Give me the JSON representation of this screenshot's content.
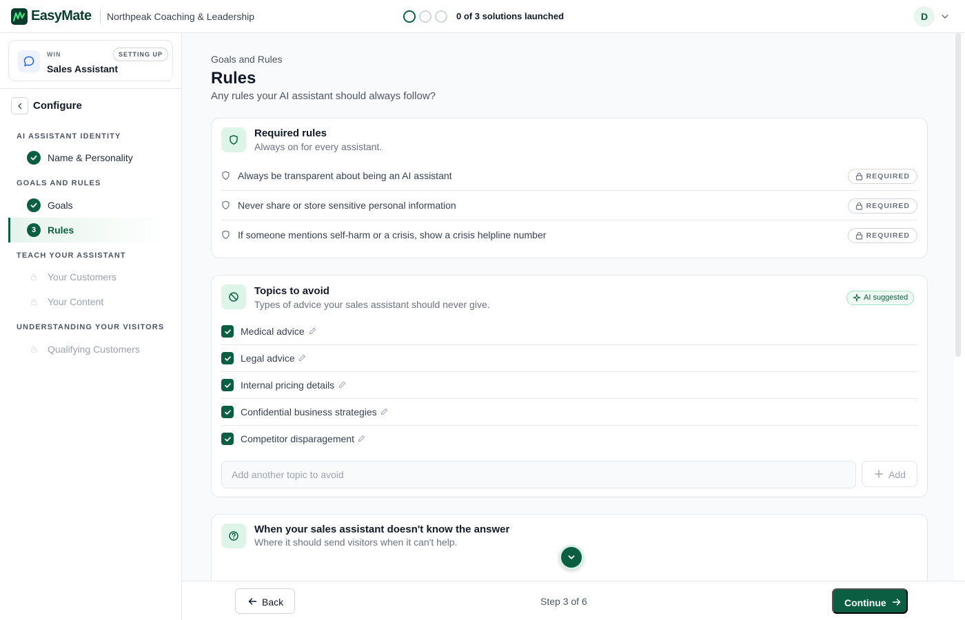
{
  "topbar": {
    "brand": "EasyMate",
    "org_name": "Northpeak Coaching & Leadership",
    "launch_status": "0 of 3 solutions launched",
    "avatar_initial": "D"
  },
  "sidebar": {
    "solution": {
      "eyebrow": "WIN",
      "name": "Sales Assistant",
      "status": "SETTING UP"
    },
    "configure_title": "Configure",
    "sections": [
      {
        "heading": "AI ASSISTANT IDENTITY",
        "items": [
          {
            "label": "Name & Personality",
            "state": "done"
          }
        ]
      },
      {
        "heading": "GOALS AND RULES",
        "items": [
          {
            "label": "Goals",
            "state": "done"
          },
          {
            "label": "Rules",
            "state": "active",
            "number": "3"
          }
        ]
      },
      {
        "heading": "TEACH YOUR ASSISTANT",
        "items": [
          {
            "label": "Your Customers",
            "state": "locked"
          },
          {
            "label": "Your Content",
            "state": "locked"
          }
        ]
      },
      {
        "heading": "UNDERSTANDING YOUR VISITORS",
        "items": [
          {
            "label": "Qualifying Customers",
            "state": "locked"
          }
        ]
      }
    ]
  },
  "main": {
    "breadcrumb": "Goals and Rules",
    "title": "Rules",
    "subtitle": "Any rules your AI assistant should always follow?",
    "required_card": {
      "title": "Required rules",
      "subtitle": "Always on for every assistant.",
      "badge": "REQUIRED",
      "rules": [
        "Always be transparent about being an AI assistant",
        "Never share or store sensitive personal information",
        "If someone mentions self-harm or a crisis, show a crisis helpline number"
      ]
    },
    "topics_card": {
      "title": "Topics to avoid",
      "subtitle": "Types of advice your sales assistant should never give.",
      "ai_badge": "AI suggested",
      "topics": [
        {
          "label": "Medical advice",
          "checked": true
        },
        {
          "label": "Legal advice",
          "checked": true
        },
        {
          "label": "Internal pricing details",
          "checked": true
        },
        {
          "label": "Confidential business strategies",
          "checked": true
        },
        {
          "label": "Competitor disparagement",
          "checked": true
        }
      ],
      "input_placeholder": "Add another topic to avoid",
      "add_label": "Add"
    },
    "unknown_card": {
      "title": "When your sales assistant doesn't know the answer",
      "subtitle": "Where it should send visitors when it can't help."
    }
  },
  "footer": {
    "back_label": "Back",
    "step_text": "Step 3 of 6",
    "continue_label": "Continue"
  },
  "colors": {
    "brand_green": "#0b5e42",
    "brand_dark": "#0b3d2e",
    "accent_lime": "#4ade80",
    "light_green_bg": "#ddf4e8"
  },
  "icons": {
    "logo": "easymate-logo-icon",
    "solution": "chat-bubble-icon",
    "required": "shield-icon",
    "topics": "ban-icon",
    "unknown": "question-circle-icon",
    "ai": "sparkle-icon",
    "lock": "lock-icon",
    "edit": "pencil-icon",
    "add": "plus-icon",
    "back": "arrow-left-icon",
    "continue": "arrow-right-icon",
    "scroll": "chevron-down-icon"
  }
}
